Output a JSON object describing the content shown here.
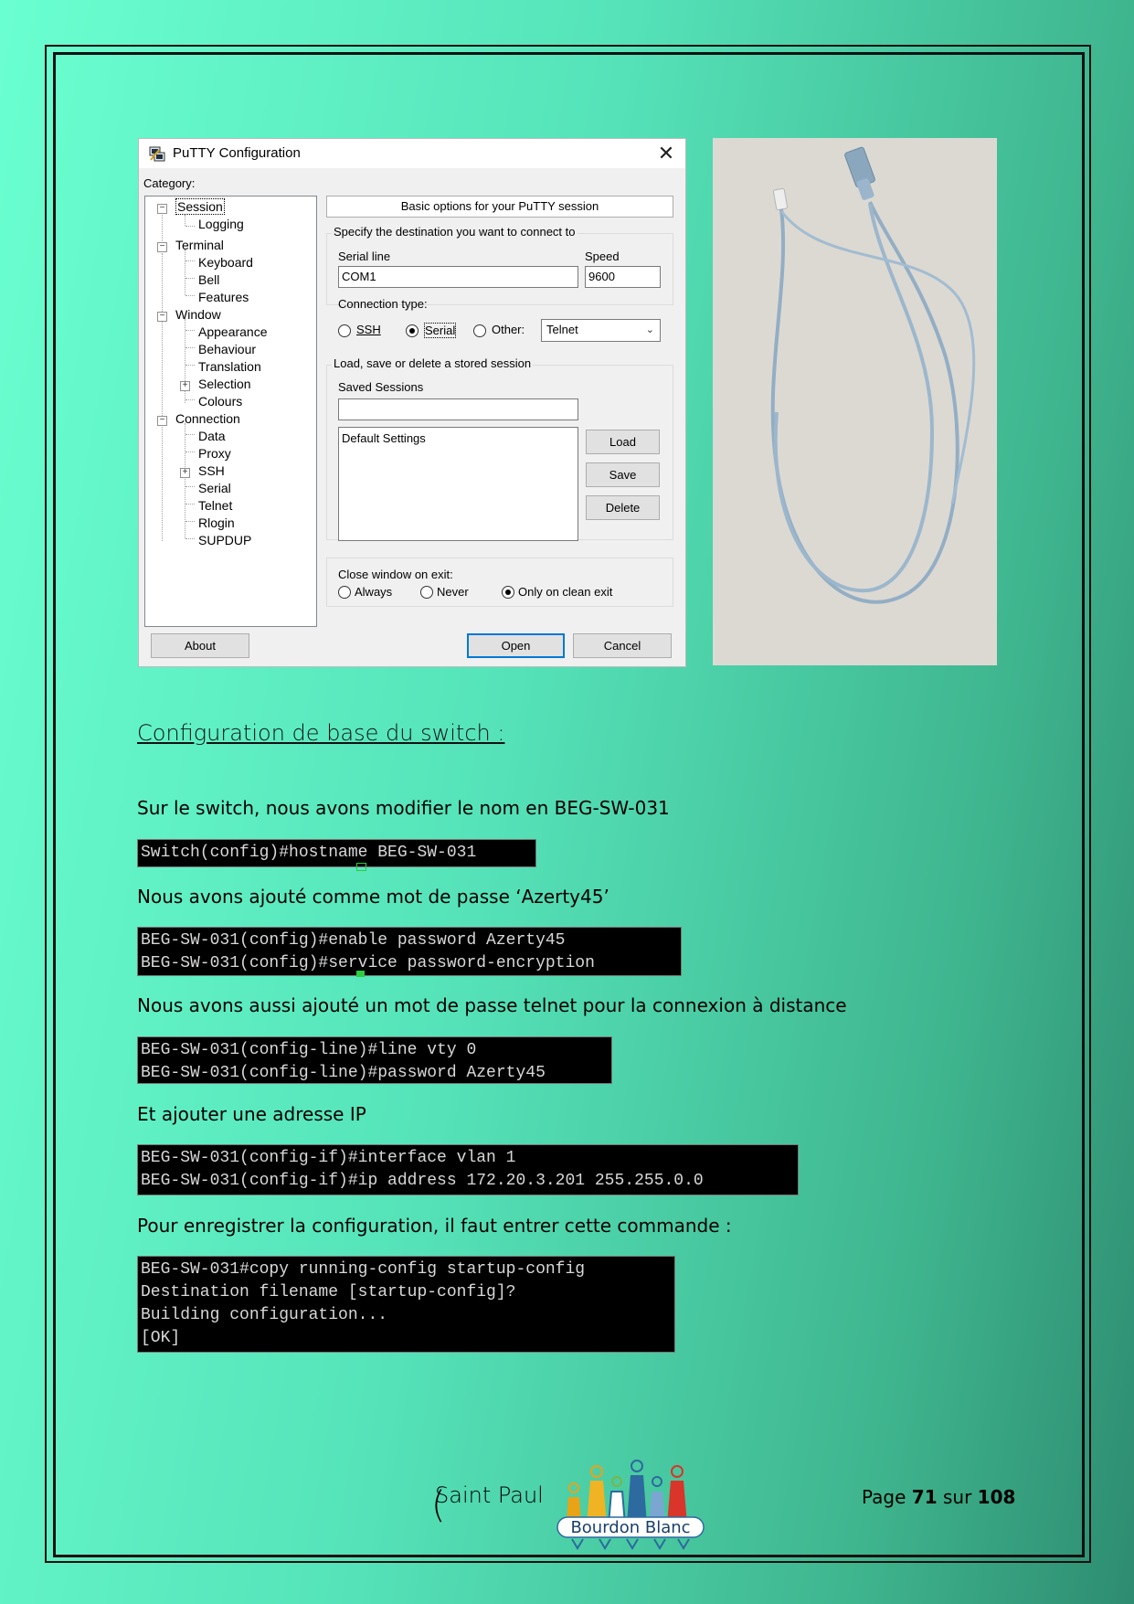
{
  "putty": {
    "title": "PuTTY Configuration",
    "close_symbol": "✕",
    "category_label": "Category:",
    "tree": [
      {
        "label": "Session"
      },
      {
        "label": "Logging"
      },
      {
        "label": "Terminal"
      },
      {
        "label": "Keyboard"
      },
      {
        "label": "Bell"
      },
      {
        "label": "Features"
      },
      {
        "label": "Window"
      },
      {
        "label": "Appearance"
      },
      {
        "label": "Behaviour"
      },
      {
        "label": "Translation"
      },
      {
        "label": "Selection"
      },
      {
        "label": "Colours"
      },
      {
        "label": "Connection"
      },
      {
        "label": "Data"
      },
      {
        "label": "Proxy"
      },
      {
        "label": "SSH"
      },
      {
        "label": "Serial"
      },
      {
        "label": "Telnet"
      },
      {
        "label": "Rlogin"
      },
      {
        "label": "SUPDUP"
      }
    ],
    "header": "Basic options for your PuTTY session",
    "destination_group": "Specify the destination you want to connect to",
    "serial_line_label": "Serial line",
    "serial_line_value": "COM1",
    "speed_label": "Speed",
    "speed_value": "9600",
    "connection_type_label": "Connection type:",
    "conn_ssh": "SSH",
    "conn_serial": "Serial",
    "conn_other": "Other:",
    "other_value": "Telnet",
    "sessions_group": "Load, save or delete a stored session",
    "saved_sessions_label": "Saved Sessions",
    "saved_sessions_value": "",
    "sessions_list": [
      "Default Settings"
    ],
    "load_button": "Load",
    "save_button": "Save",
    "delete_button": "Delete",
    "close_on_exit_label": "Close window on exit:",
    "exit_always": "Always",
    "exit_never": "Never",
    "exit_clean": "Only on clean exit",
    "about_button": "About",
    "open_button": "Open",
    "cancel_button": "Cancel"
  },
  "content": {
    "section_title": "Configuration de base du switch :",
    "para1": "Sur le switch, nous avons modifier le nom en BEG-SW-031",
    "term1": "Switch(config)#hostname BEG-SW-031",
    "para2": "Nous avons ajouté comme mot de passe ‘Azerty45’",
    "term2": "BEG-SW-031(config)#enable password Azerty45\nBEG-SW-031(config)#service password-encryption",
    "para3": "Nous avons aussi ajouté un mot de passe telnet pour la connexion à distance",
    "term3": "BEG-SW-031(config-line)#line vty 0\nBEG-SW-031(config-line)#password Azerty45",
    "para4": "Et ajouter une adresse IP",
    "term4": "BEG-SW-031(config-if)#interface vlan 1\nBEG-SW-031(config-if)#ip address 172.20.3.201 255.255.0.0",
    "para5": "Pour enregistrer la configuration, il faut entrer cette commande :",
    "term5": "BEG-SW-031#copy running-config startup-config\nDestination filename [startup-config]?\nBuilding configuration...\n[OK]"
  },
  "footer": {
    "paren": "(",
    "school": "Saint Paul",
    "logo_text": "Bourdon Blanc",
    "page_prefix": "Page ",
    "page_current": "71",
    "page_mid": " sur ",
    "page_total": "108"
  }
}
